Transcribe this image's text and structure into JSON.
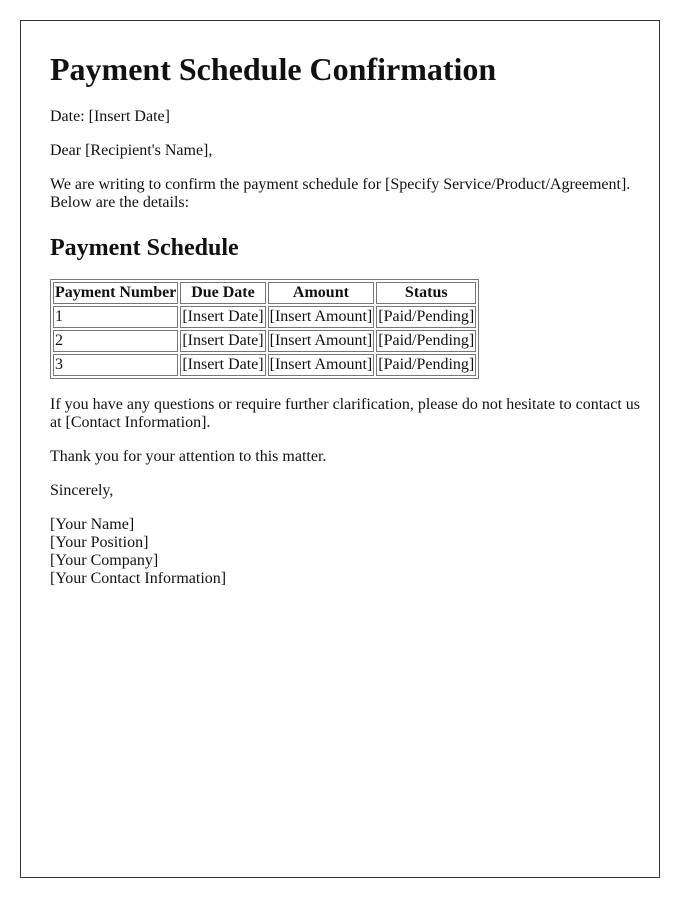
{
  "document": {
    "title": "Payment Schedule Confirmation",
    "date_line": "Date: [Insert Date]",
    "greeting": "Dear [Recipient's Name],",
    "intro": "We are writing to confirm the payment schedule for [Specify Service/Product/Agreement]. Below are the details:",
    "section_heading": "Payment Schedule",
    "table": {
      "headers": [
        "Payment Number",
        "Due Date",
        "Amount",
        "Status"
      ],
      "rows": [
        [
          "1",
          "[Insert Date]",
          "[Insert Amount]",
          "[Paid/Pending]"
        ],
        [
          "2",
          "[Insert Date]",
          "[Insert Amount]",
          "[Paid/Pending]"
        ],
        [
          "3",
          "[Insert Date]",
          "[Insert Amount]",
          "[Paid/Pending]"
        ]
      ]
    },
    "questions": "If you have any questions or require further clarification, please do not hesitate to contact us at [Contact Information].",
    "thanks": "Thank you for your attention to this matter.",
    "closing": "Sincerely,",
    "signature": {
      "name": "[Your Name]",
      "position": "[Your Position]",
      "company": "[Your Company]",
      "contact": "[Your Contact Information]"
    }
  }
}
